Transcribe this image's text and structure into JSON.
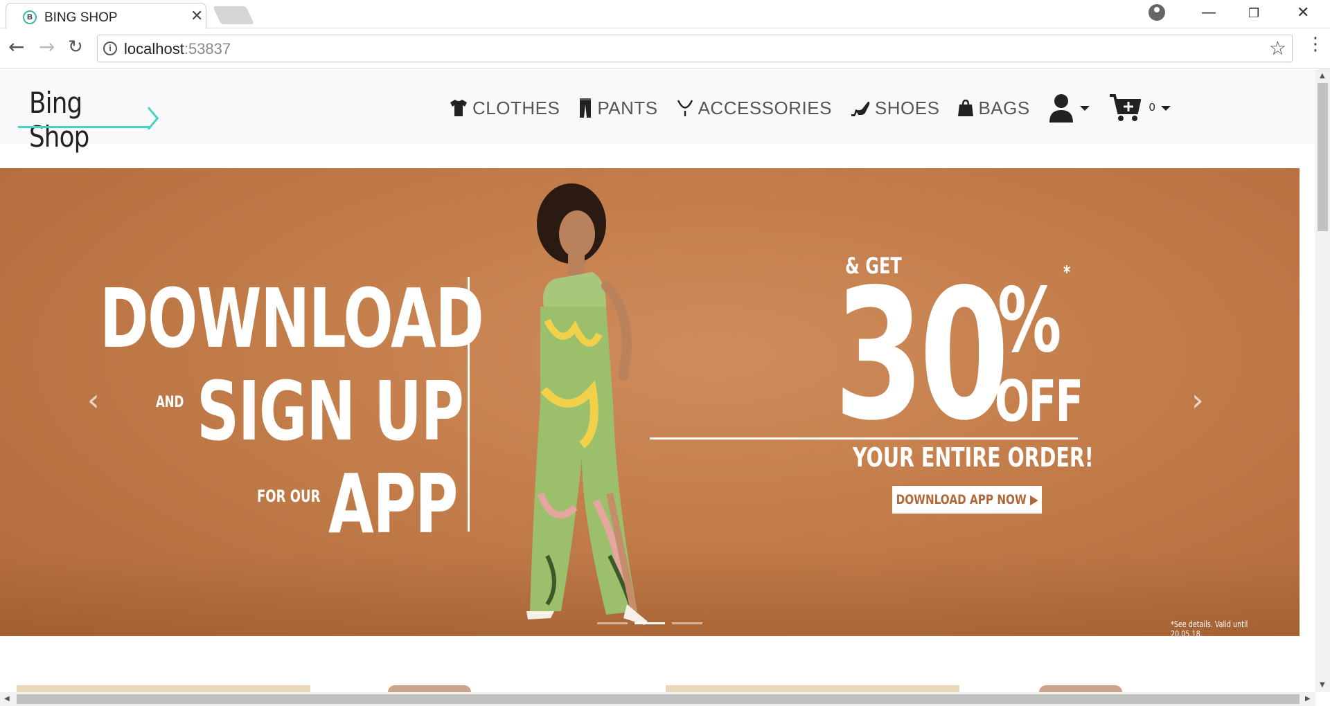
{
  "browser": {
    "tab_title": "BING SHOP",
    "tab_favicon_letter": "B",
    "url_host": "localhost",
    "url_port": ":53837"
  },
  "site": {
    "logo_text": "Bing Shop",
    "menu": [
      {
        "label": "CLOTHES",
        "icon": "tshirt-icon"
      },
      {
        "label": "PANTS",
        "icon": "pants-icon"
      },
      {
        "label": "ACCESSORIES",
        "icon": "necklace-icon"
      },
      {
        "label": "SHOES",
        "icon": "high-heel-icon"
      },
      {
        "label": "BAGS",
        "icon": "bag-icon"
      }
    ],
    "cart_count": "0"
  },
  "banner": {
    "line_download": "DOWNLOAD",
    "word_and": "AND",
    "line_signup": "SIGN UP",
    "word_for_our": "FOR OUR",
    "line_app": "APP",
    "get": "& GET",
    "percent": "30",
    "percent_sign": "%",
    "asterisk": "*",
    "off": "OFF",
    "entire_order": "YOUR ENTIRE ORDER!",
    "cta": "DOWNLOAD APP NOW ▶",
    "fine_print": "*See details. Valid until 20.05.18.",
    "active_slide": 2,
    "slide_count": 3
  },
  "colors": {
    "accent_teal": "#47d1c1",
    "banner_bg": "#c27d4b",
    "nav_bg": "#f8f9fa"
  }
}
